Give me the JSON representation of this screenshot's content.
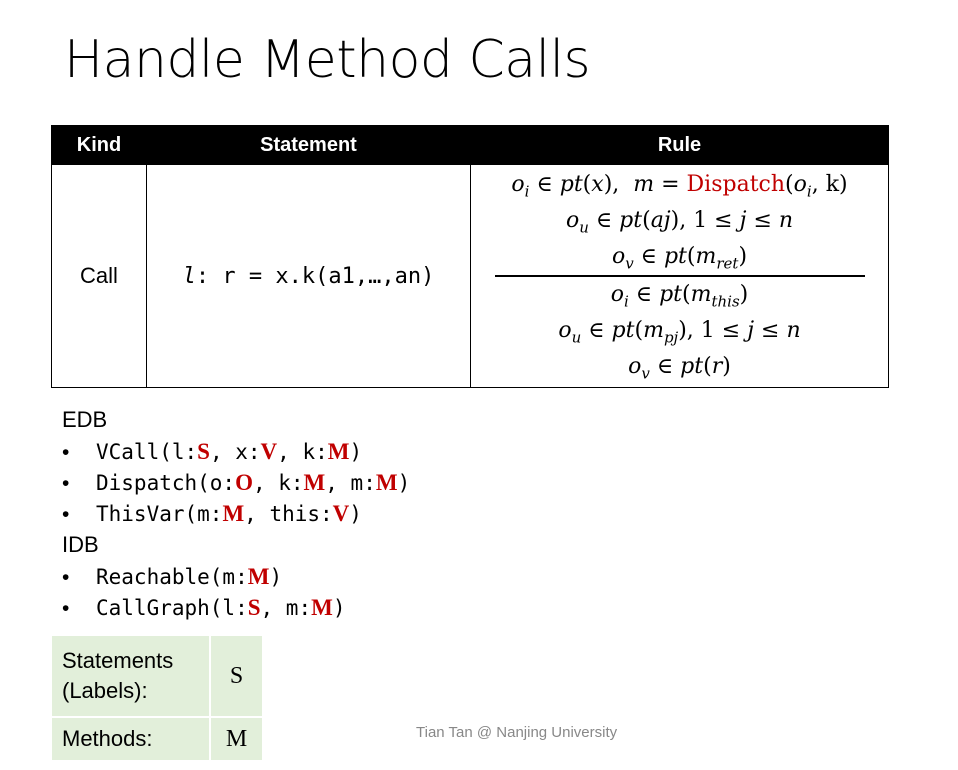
{
  "title": "Handle Method Calls",
  "table": {
    "headers": [
      "Kind",
      "Statement",
      "Rule"
    ],
    "kind": "Call",
    "statement": {
      "label": "l",
      "code": ": r = x.k(a1,…,an)"
    }
  },
  "edb": {
    "heading": "EDB",
    "items": [
      [
        {
          "t": "VCall(l:"
        },
        {
          "t": "S",
          "typ": true
        },
        {
          "t": ", x:"
        },
        {
          "t": "V",
          "typ": true
        },
        {
          "t": ", k:"
        },
        {
          "t": "M",
          "typ": true
        },
        {
          "t": ")"
        }
      ],
      [
        {
          "t": "Dispatch(o:"
        },
        {
          "t": "O",
          "typ": true
        },
        {
          "t": ", k:"
        },
        {
          "t": "M",
          "typ": true
        },
        {
          "t": ", m:"
        },
        {
          "t": "M",
          "typ": true
        },
        {
          "t": ")"
        }
      ],
      [
        {
          "t": "ThisVar(m:"
        },
        {
          "t": "M",
          "typ": true
        },
        {
          "t": ", this:"
        },
        {
          "t": "V",
          "typ": true
        },
        {
          "t": ")"
        }
      ]
    ]
  },
  "idb": {
    "heading": "IDB",
    "items": [
      [
        {
          "t": "Reachable(m:"
        },
        {
          "t": "M",
          "typ": true
        },
        {
          "t": ")"
        }
      ],
      [
        {
          "t": "CallGraph(l:"
        },
        {
          "t": "S",
          "typ": true
        },
        {
          "t": ", m:"
        },
        {
          "t": "M",
          "typ": true
        },
        {
          "t": ")"
        }
      ]
    ]
  },
  "legend": {
    "statements_label": "Statements (Labels):",
    "statements_symbol": "S",
    "methods_label": "Methods:",
    "methods_symbol": "M"
  },
  "footer": "Tian Tan @ Nanjing University",
  "colors": {
    "type_red": "#c00000",
    "legend_bg": "#e2efda",
    "header_bg": "#000000"
  }
}
